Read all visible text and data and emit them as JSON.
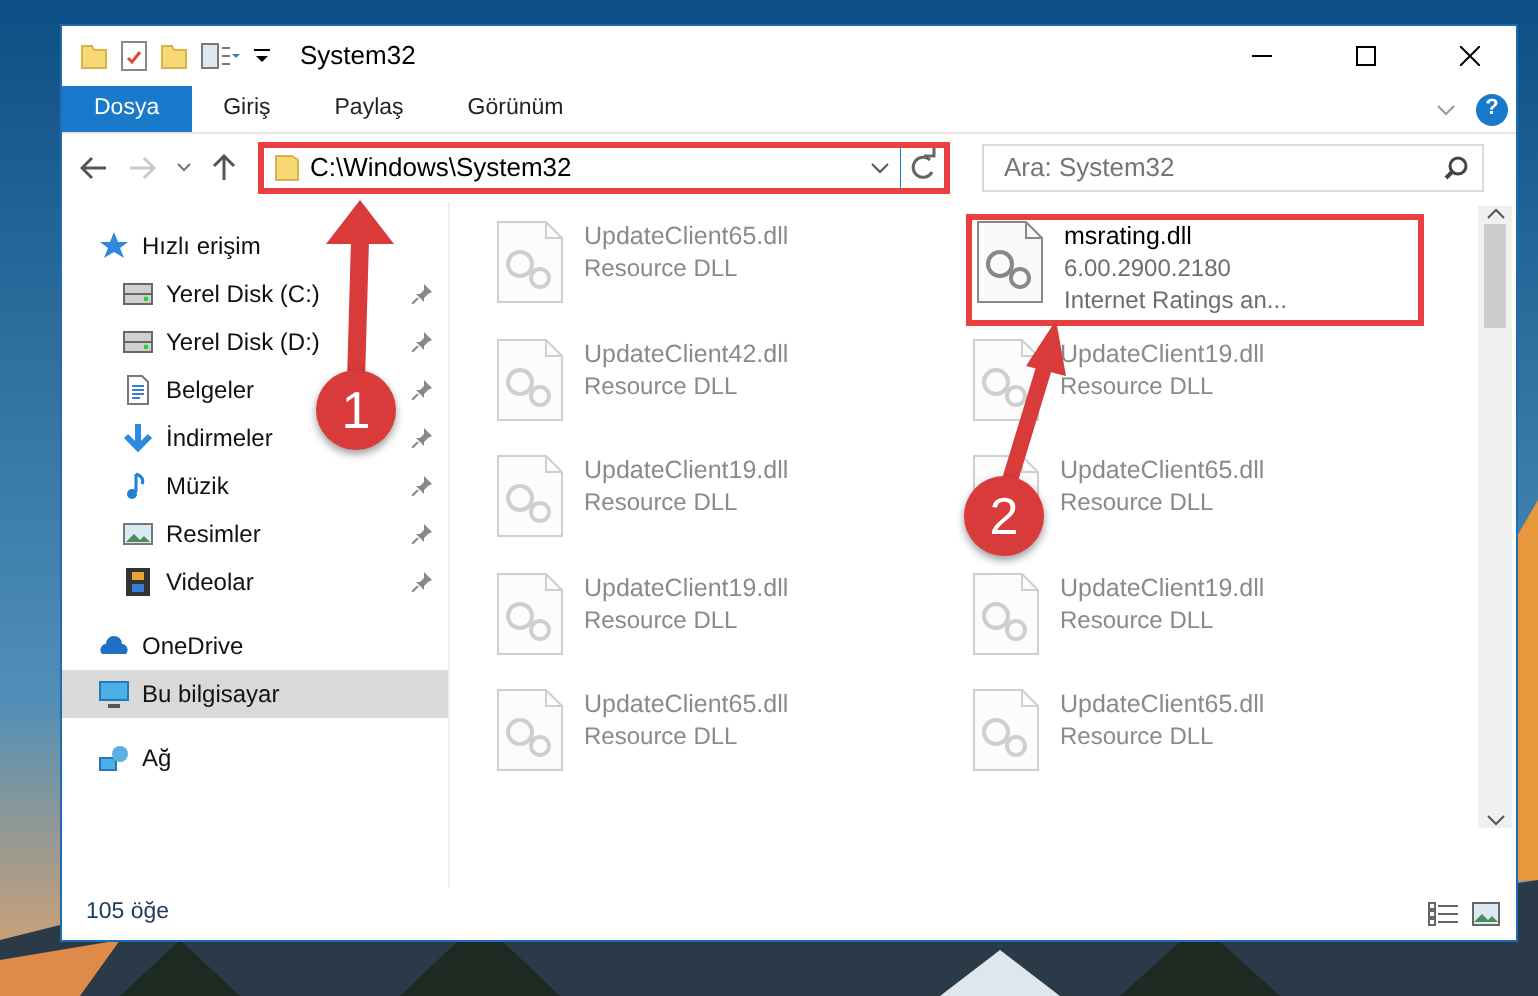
{
  "window": {
    "title": "System32"
  },
  "ribbon": {
    "tabs": [
      {
        "label": "Dosya",
        "selected": true
      },
      {
        "label": "Giriş",
        "selected": false
      },
      {
        "label": "Paylaş",
        "selected": false
      },
      {
        "label": "Görünüm",
        "selected": false
      }
    ],
    "help": "?"
  },
  "navigation": {
    "forward_disabled": true
  },
  "address": {
    "value": "C:\\Windows\\System32",
    "highlighted": true
  },
  "search": {
    "placeholder": "Ara: System32"
  },
  "sidebar": {
    "items": [
      {
        "label": "Hızlı erişim",
        "kind": "quickaccess",
        "pinned": false,
        "selected": false
      },
      {
        "label": "Yerel Disk (C:)",
        "kind": "drive",
        "pinned": true,
        "selected": false
      },
      {
        "label": "Yerel Disk (D:)",
        "kind": "drive",
        "pinned": true,
        "selected": false
      },
      {
        "label": "Belgeler",
        "kind": "documents",
        "pinned": true,
        "selected": false
      },
      {
        "label": "İndirmeler",
        "kind": "downloads",
        "pinned": true,
        "selected": false
      },
      {
        "label": "Müzik",
        "kind": "music",
        "pinned": true,
        "selected": false
      },
      {
        "label": "Resimler",
        "kind": "pictures",
        "pinned": true,
        "selected": false
      },
      {
        "label": "Videolar",
        "kind": "videos",
        "pinned": true,
        "selected": false
      },
      {
        "label": "OneDrive",
        "kind": "cloud",
        "pinned": false,
        "selected": false
      },
      {
        "label": "Bu bilgisayar",
        "kind": "computer",
        "pinned": false,
        "selected": true
      },
      {
        "label": "Ağ",
        "kind": "network",
        "pinned": false,
        "selected": false
      }
    ]
  },
  "files": [
    {
      "name": "UpdateClient65.dll",
      "lines": [
        "Resource DLL"
      ],
      "blurred": true,
      "highlighted": false
    },
    {
      "name": "msrating.dll",
      "lines": [
        "6.00.2900.2180",
        "Internet Ratings an..."
      ],
      "blurred": false,
      "highlighted": true
    },
    {
      "name": "UpdateClient42.dll",
      "lines": [
        "Resource DLL"
      ],
      "blurred": true,
      "highlighted": false
    },
    {
      "name": "UpdateClient19.dll",
      "lines": [
        "Resource DLL"
      ],
      "blurred": true,
      "highlighted": false
    },
    {
      "name": "UpdateClient19.dll",
      "lines": [
        "Resource DLL"
      ],
      "blurred": true,
      "highlighted": false
    },
    {
      "name": "UpdateClient65.dll",
      "lines": [
        "Resource DLL"
      ],
      "blurred": true,
      "highlighted": false
    },
    {
      "name": "UpdateClient19.dll",
      "lines": [
        "Resource DLL"
      ],
      "blurred": true,
      "highlighted": false
    },
    {
      "name": "UpdateClient19.dll",
      "lines": [
        "Resource DLL"
      ],
      "blurred": true,
      "highlighted": false
    },
    {
      "name": "UpdateClient65.dll",
      "lines": [
        "Resource DLL"
      ],
      "blurred": true,
      "highlighted": false
    },
    {
      "name": "UpdateClient65.dll",
      "lines": [
        "Resource DLL"
      ],
      "blurred": true,
      "highlighted": false
    }
  ],
  "status_bar": {
    "count": "105 öğe"
  },
  "callouts": [
    {
      "label": "1"
    },
    {
      "label": "2"
    }
  ]
}
